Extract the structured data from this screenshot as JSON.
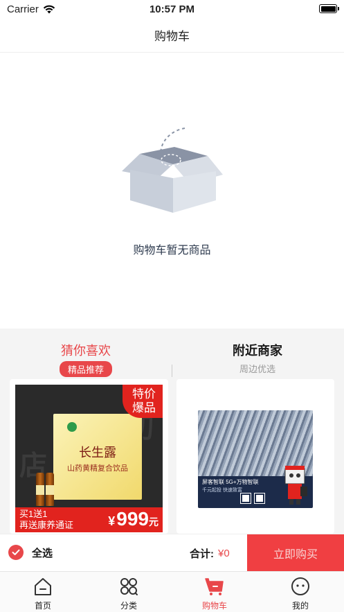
{
  "status_bar": {
    "carrier": "Carrier",
    "time": "10:57 PM"
  },
  "nav": {
    "title": "购物车"
  },
  "empty_state": {
    "message": "购物车暂无商品"
  },
  "recommend": {
    "tabs": [
      {
        "title": "猜你喜欢",
        "badge": "精品推荐",
        "active": true
      },
      {
        "title": "附近商家",
        "subtitle": "周边优选",
        "active": false
      }
    ],
    "product": {
      "box_name": "长生露",
      "box_line": "山药黄精复合饮品",
      "corner_tag": [
        "特价",
        "爆品"
      ],
      "promo": [
        "买1送1",
        "再送康养通证"
      ],
      "currency": "¥",
      "price": "999",
      "unit": "元"
    },
    "ad": {
      "title": "屏客智联  5G+万物智联",
      "subtitle": "千元起投  快速致富"
    }
  },
  "action_bar": {
    "select_all_label": "全选",
    "total_label": "合计:",
    "total_value": "¥0",
    "buy_label": "立即购买",
    "accent_color": "#e8474a"
  },
  "tab_bar": {
    "items": [
      {
        "label": "首页",
        "icon": "home-icon"
      },
      {
        "label": "分类",
        "icon": "category-icon"
      },
      {
        "label": "购物车",
        "icon": "cart-icon",
        "active": true
      },
      {
        "label": "我的",
        "icon": "profile-icon"
      }
    ]
  }
}
